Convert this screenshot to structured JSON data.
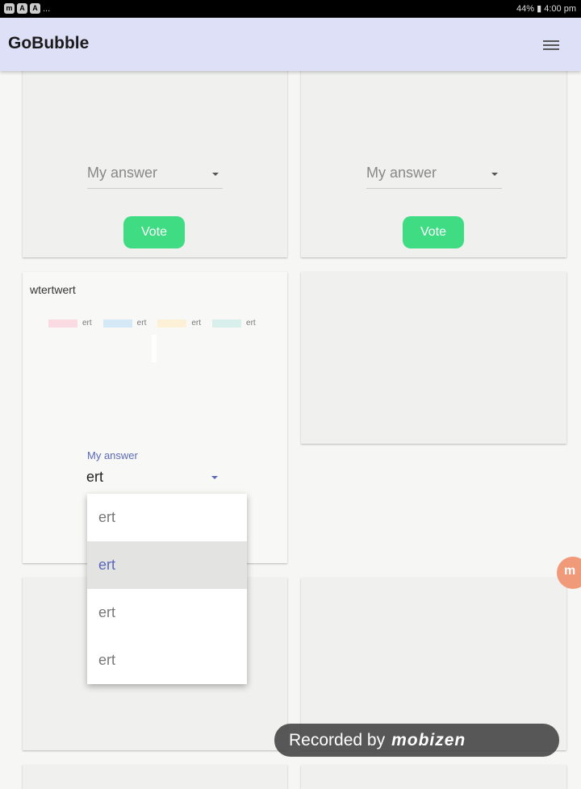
{
  "status_bar": {
    "left_icons": [
      "mobizen-icon",
      "app-icon",
      "app-icon"
    ],
    "overflow": "...",
    "battery": "44%",
    "time": "4:00 pm"
  },
  "app_bar": {
    "title": "GoBubble",
    "menu_icon": "hamburger-icon"
  },
  "cards": [
    {
      "select_placeholder": "My answer",
      "vote_label": "Vote"
    },
    {
      "select_placeholder": "My answer",
      "vote_label": "Vote"
    },
    {
      "title": "wtertwert",
      "legend": [
        {
          "label": "ert",
          "color": "#fadbe1"
        },
        {
          "label": "ert",
          "color": "#d5e8f6"
        },
        {
          "label": "ert",
          "color": "#fcf0d6"
        },
        {
          "label": "ert",
          "color": "#d8efec"
        }
      ],
      "select_label": "My answer",
      "select_value": "ert",
      "options": [
        "ert",
        "ert",
        "ert",
        "ert"
      ],
      "highlighted_option": 1
    }
  ],
  "overlay": {
    "recorded_by": "Recorded by",
    "brand": "mobizen",
    "bubble": "m"
  }
}
